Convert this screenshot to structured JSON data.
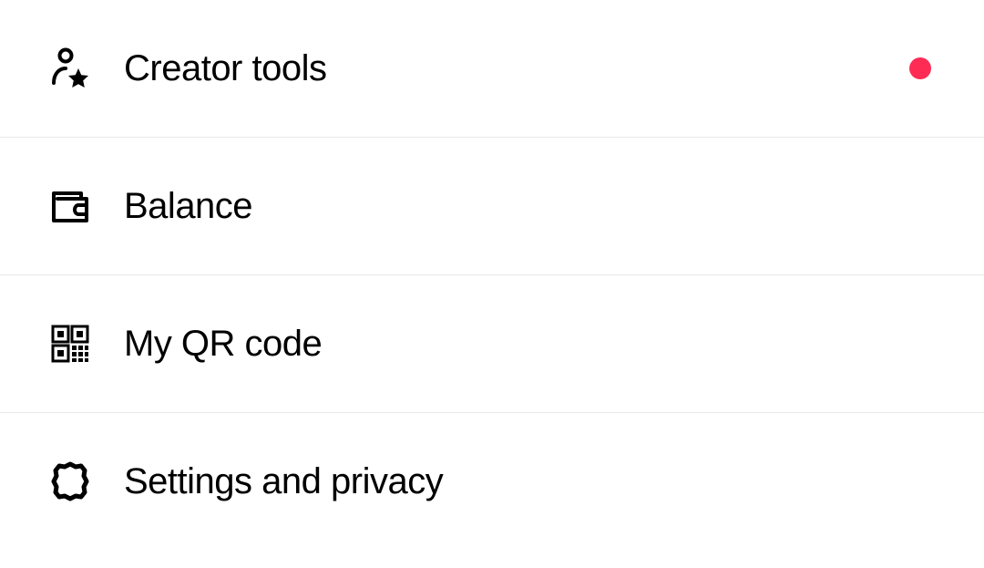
{
  "menu": {
    "items": [
      {
        "label": "Creator tools",
        "icon": "creator-tools",
        "hasNotification": true
      },
      {
        "label": "Balance",
        "icon": "wallet",
        "hasNotification": false
      },
      {
        "label": "My QR code",
        "icon": "qr-code",
        "hasNotification": false
      },
      {
        "label": "Settings and privacy",
        "icon": "settings",
        "hasNotification": false
      }
    ]
  },
  "colors": {
    "notification": "#fe2c55",
    "divider": "#e8e8e8",
    "text": "#000000"
  }
}
